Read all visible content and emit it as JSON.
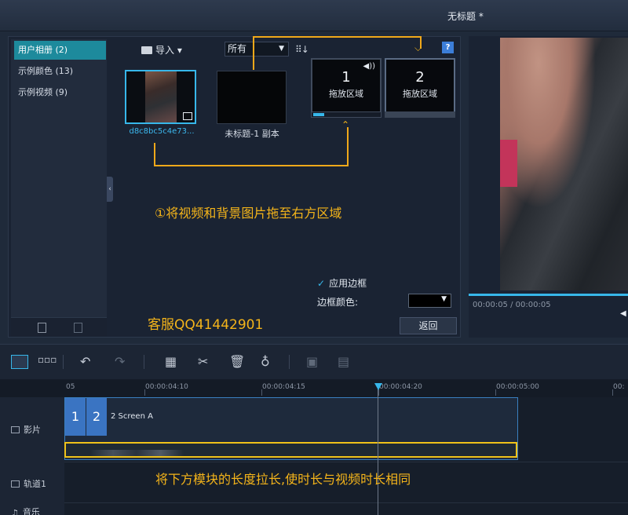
{
  "window": {
    "title": "无标题 *"
  },
  "albums": [
    {
      "label": "用户相册 (2)",
      "selected": true
    },
    {
      "label": "示例颜色 (13)",
      "selected": false
    },
    {
      "label": "示例视频 (9)",
      "selected": false
    }
  ],
  "media": {
    "import_label": "导入 ▾",
    "filter_value": "所有",
    "items": [
      {
        "label": "d8c8bc5c4e73..."
      },
      {
        "label": "未标题-1 副本"
      }
    ]
  },
  "dropzones": [
    {
      "number": "1",
      "label": "拖放区域"
    },
    {
      "number": "2",
      "label": "拖放区域"
    }
  ],
  "help_label": "?",
  "border": {
    "apply_label": "应用边框",
    "checked": true,
    "color_label": "边框颜色:",
    "color": "#000000"
  },
  "back_label": "返回",
  "preview": {
    "timecode": "00:00:05 / 00:00:05",
    "progress": 1.0
  },
  "annotations": {
    "step1": "①将视频和背景图片拖至右方区域",
    "service": "客服QQ41442901",
    "step2": "将下方模块的长度拉长,使时长与视频时长相同"
  },
  "timeline": {
    "ticks": [
      "05",
      "00:00:04:10",
      "00:00:04:15",
      "00:00:04:20",
      "00:00:05:00",
      "00:"
    ],
    "tracks": [
      {
        "label": "影片"
      },
      {
        "label": "轨道1"
      },
      {
        "label": "音乐"
      }
    ],
    "clip": {
      "cells": [
        "1",
        "2"
      ],
      "name": "2 Screen A"
    }
  },
  "colors": {
    "accent": "#37b7ea",
    "annotation": "#f4b41a",
    "selected_album": "#1d8a9c"
  }
}
